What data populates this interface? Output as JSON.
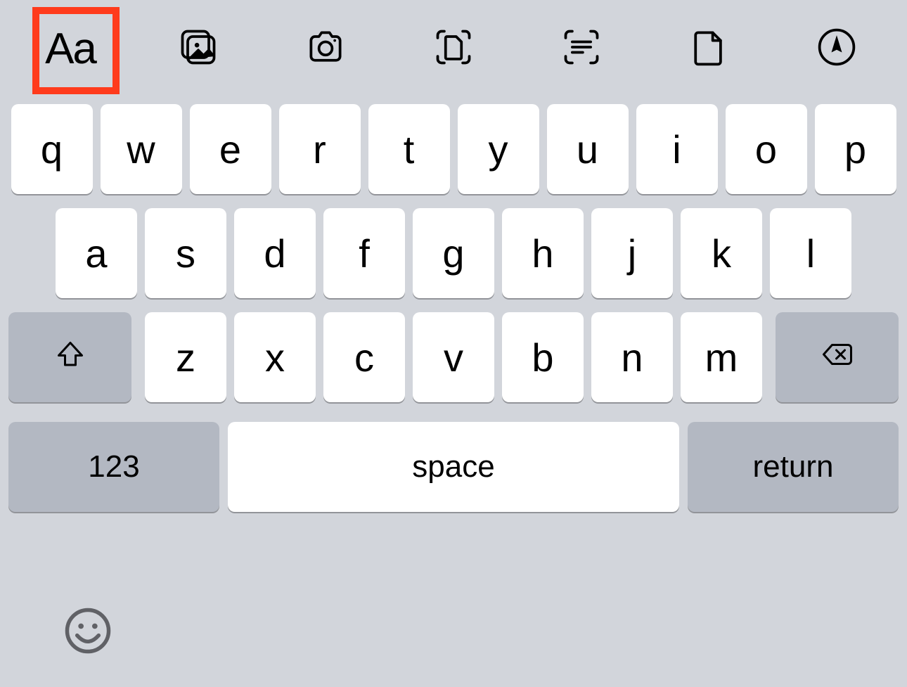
{
  "toolbar": {
    "text_format_label": "Aa",
    "icons": [
      "text-format",
      "photos",
      "camera",
      "scan-document",
      "scan-text",
      "attach-file",
      "markup"
    ],
    "highlighted_index": 0
  },
  "keyboard": {
    "row1": [
      "q",
      "w",
      "e",
      "r",
      "t",
      "y",
      "u",
      "i",
      "o",
      "p"
    ],
    "row2": [
      "a",
      "s",
      "d",
      "f",
      "g",
      "h",
      "j",
      "k",
      "l"
    ],
    "row3": [
      "z",
      "x",
      "c",
      "v",
      "b",
      "n",
      "m"
    ],
    "numbers_label": "123",
    "space_label": "space",
    "return_label": "return"
  }
}
